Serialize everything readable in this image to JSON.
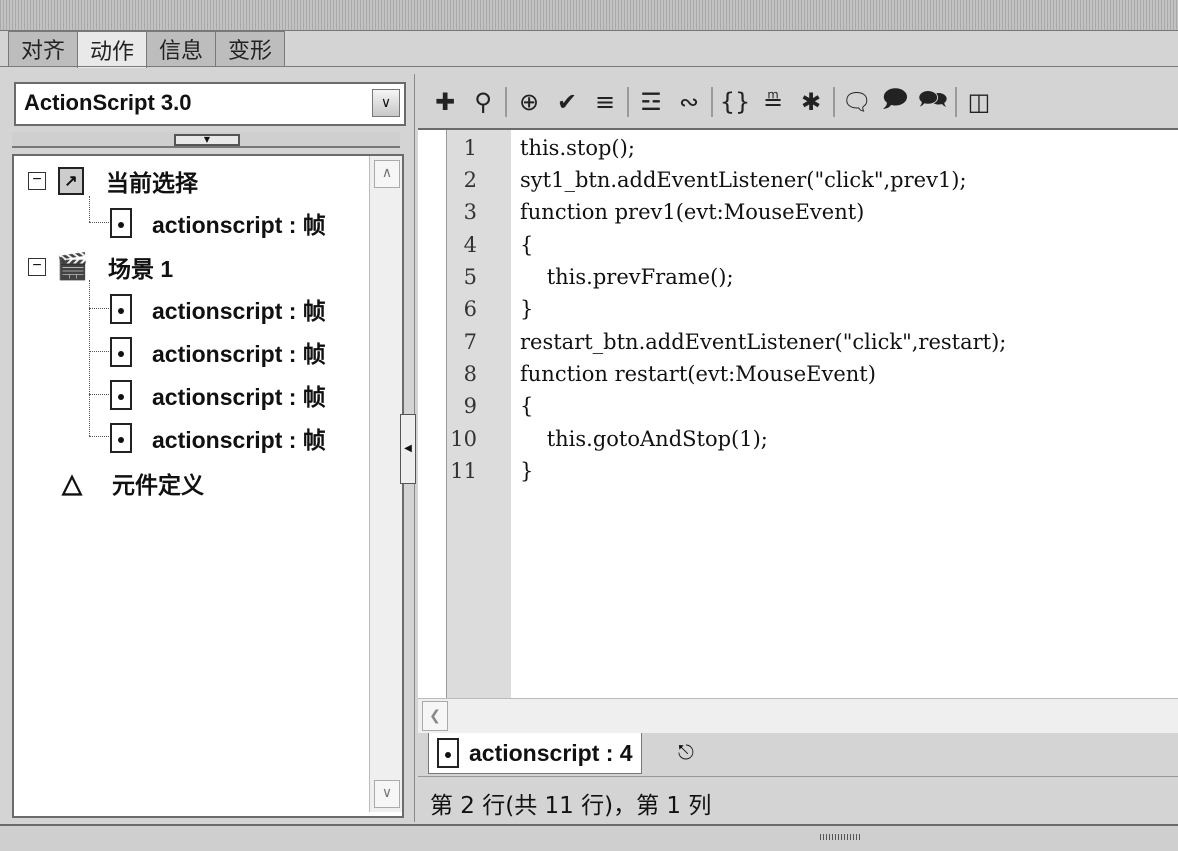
{
  "tabs": [
    {
      "label": "对齐"
    },
    {
      "label": "动作",
      "active": true
    },
    {
      "label": "信息"
    },
    {
      "label": "变形"
    }
  ],
  "script_selector": {
    "value": "ActionScript 3.0"
  },
  "tree": {
    "current_selection": "当前选择",
    "current_frame": "actionscript : 帧",
    "scene": "场景 1",
    "scene_frames": [
      "actionscript : 帧",
      "actionscript : 帧",
      "actionscript : 帧",
      "actionscript : 帧"
    ],
    "symbol_definitions": "元件定义",
    "expand_glyph": "⊟"
  },
  "toolbar": {
    "icons": [
      "add-statement-icon",
      "find-icon",
      "target-path-icon",
      "check-syntax-icon",
      "auto-format-icon",
      "code-hint-icon",
      "debug-options-icon",
      "collapse-between-braces-icon",
      "collapse-selection-icon",
      "expand-all-icon",
      "apply-block-comment-icon",
      "apply-line-comment-icon",
      "remove-comment-icon",
      "show-hide-toolbox-icon"
    ]
  },
  "code": {
    "line_numbers": [
      "1",
      "2",
      "3",
      "4",
      "5",
      "6",
      "7",
      "8",
      "9",
      "10",
      "11"
    ],
    "lines": [
      "this.stop();",
      "syt1_btn.addEventListener(\"click\",prev1);",
      "function prev1(evt:MouseEvent)",
      "{",
      "    this.prevFrame();",
      "}",
      "restart_btn.addEventListener(\"click\",restart);",
      "function restart(evt:MouseEvent)",
      "{",
      "    this.gotoAndStop(1);",
      "}"
    ]
  },
  "script_tab": {
    "label": "actionscript : 4"
  },
  "status": {
    "text": "第 2 行(共 11 行)，第 1 列"
  }
}
